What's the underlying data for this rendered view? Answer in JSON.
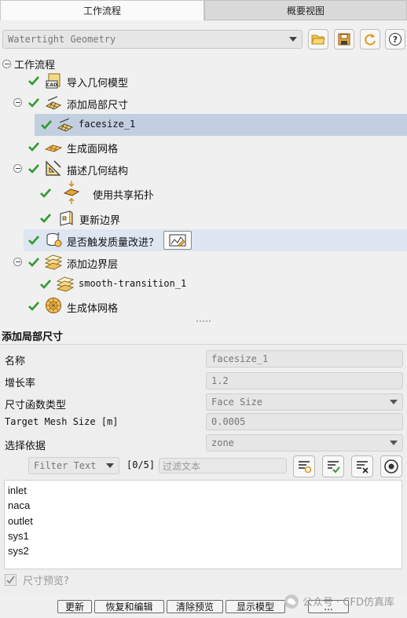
{
  "tabs": [
    {
      "label": "工作流程",
      "active": true
    },
    {
      "label": "概要视图",
      "active": false
    }
  ],
  "workflow_select": {
    "value": "Watertight Geometry"
  },
  "toolbar_icons": [
    "open-folder-icon",
    "save-icon",
    "refresh-icon",
    "help-icon"
  ],
  "tree": {
    "root": {
      "label": "工作流程",
      "expanded": true
    },
    "items": [
      {
        "label": "导入几何模型",
        "icon": "cad-import-icon",
        "checked": true
      },
      {
        "label": "添加局部尺寸",
        "icon": "mesh-size-icon",
        "checked": true,
        "expanded": true
      },
      {
        "label": "facesize_1",
        "icon": "mesh-size-icon",
        "checked": true,
        "selected": true
      },
      {
        "label": "生成面网格",
        "icon": "surface-mesh-icon",
        "checked": true
      },
      {
        "label": "描述几何结构",
        "icon": "geometry-describe-icon",
        "checked": true,
        "expanded": true
      },
      {
        "label": "使用共享拓扑",
        "icon": "shared-topology-icon",
        "checked": true
      },
      {
        "label": "更新边界",
        "icon": "boundary-icon",
        "checked": true
      },
      {
        "label": "是否触发质量改进？",
        "icon": "quality-icon",
        "checked": true,
        "highlighted": true
      },
      {
        "label": "添加边界层",
        "icon": "boundary-layer-icon",
        "checked": true,
        "expanded": true
      },
      {
        "label": "smooth-transition_1",
        "icon": "boundary-layer-icon",
        "checked": true
      },
      {
        "label": "生成体网格",
        "icon": "volume-mesh-icon",
        "checked": true
      }
    ]
  },
  "properties": {
    "title": "添加局部尺寸",
    "fields": [
      {
        "label": "名称",
        "value": "facesize_1",
        "dropdown": false
      },
      {
        "label": "增长率",
        "value": "1.2",
        "dropdown": false
      },
      {
        "label": "尺寸函数类型",
        "value": "Face Size",
        "dropdown": true
      },
      {
        "label": "Target Mesh Size [m]",
        "value": "0.0005",
        "dropdown": false
      },
      {
        "label": "选择依据",
        "value": "zone",
        "dropdown": true
      }
    ],
    "filter": {
      "type": "Filter Text",
      "count": "[0/5]",
      "placeholder": "过滤文本"
    },
    "zones": [
      "inlet",
      "naca",
      "outlet",
      "sys1",
      "sys2"
    ],
    "preview": {
      "label": "尺寸预览?",
      "checked": true
    }
  },
  "buttons": [
    "更新",
    "恢复和编辑",
    "清除预览",
    "显示模型",
    "..."
  ],
  "watermark": "公众号 · CFD仿真库"
}
